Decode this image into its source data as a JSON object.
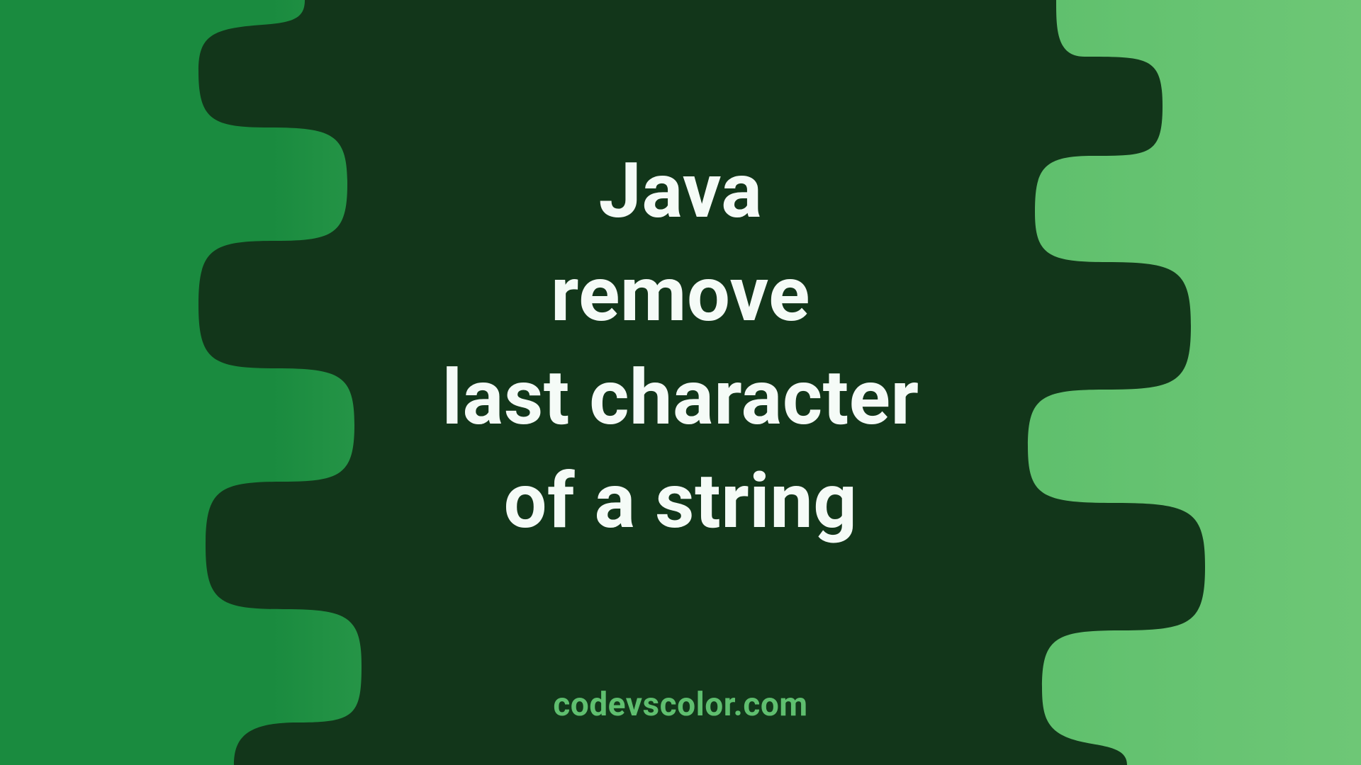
{
  "title_lines": [
    "Java",
    "remove",
    "last character",
    "of a string"
  ],
  "watermark": "codevscolor.com",
  "colors": {
    "bg_left": "#1a8b3f",
    "bg_right": "#6ec776",
    "blob": "#12361a",
    "text": "#f5fbf7",
    "watermark": "#5fbf6f"
  }
}
